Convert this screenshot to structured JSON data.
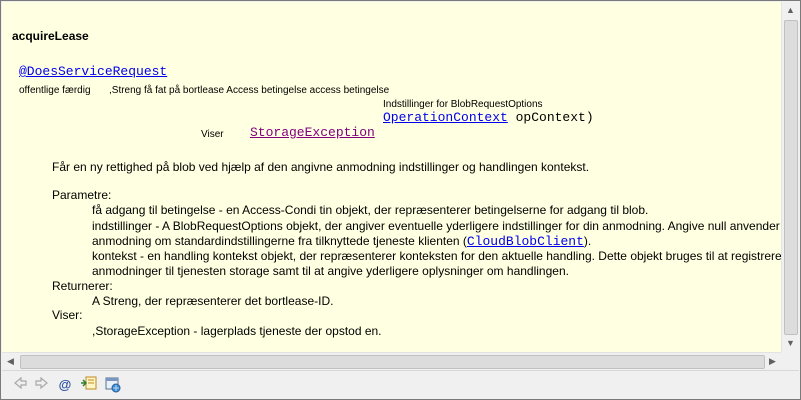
{
  "doc": {
    "title": "acquireLease",
    "annotation": "@DoesServiceRequest",
    "signature_prefix": "offentlige færdig",
    "signature_main": ",Streng få fat på bortlease Access betingelse access betingelse",
    "options_type": "Indstillinger for BlobRequestOptions",
    "context_link": "OperationContext",
    "context_param": " opContext)",
    "throws_label": "Viser",
    "throws_link": "StorageException",
    "description": "Får en ny rettighed på blob ved hjælp af den angivne anmodning indstillinger og handlingen kontekst.",
    "params_heading": "Parametre:",
    "param1": "få adgang til betingelse - en Access-Condi tin objekt, der repræsenterer betingelserne for adgang til blob.",
    "param2_line1": "indstillinger - A BlobRequestOptions objekt, der angiver eventuelle yderligere indstillinger for din anmodning. Angive null anvender den",
    "param2_line2": "anmodning om standardindstillingerne fra tilknyttede tjeneste klienten (",
    "param2_link": "CloudBlobClient",
    "param2_end": ").",
    "param3_line1": "kontekst - en handling kontekst objekt, der repræsenterer konteksten for den aktuelle handling. Dette objekt bruges til at registrere",
    "param3_line2": "anmodninger til tjenesten storage samt til at angive yderligere oplysninger om handlingen.",
    "returns_heading": "Returnerer:",
    "returns_text": "A Streng, der repræsenterer det bortlease-ID.",
    "throws_heading": "Viser:",
    "throws_text": ",StorageException - lagerplads tjeneste der opstod en."
  },
  "toolbar": {
    "icons": [
      "back-icon",
      "forward-icon",
      "javadoc-at-icon",
      "open-declaration-icon",
      "open-external-browser-icon"
    ],
    "at_symbol": "@"
  }
}
